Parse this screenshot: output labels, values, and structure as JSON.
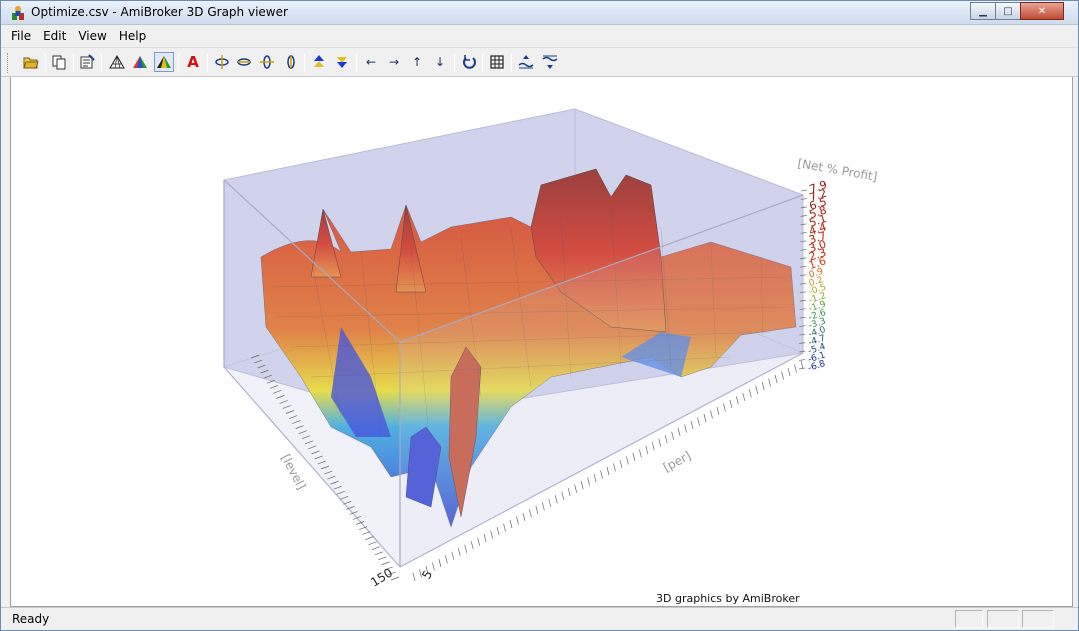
{
  "window": {
    "title": "Optimize.csv - AmiBroker 3D Graph viewer",
    "icon": "amibroker-app-icon",
    "controls": [
      "minimize",
      "maximize",
      "close"
    ]
  },
  "menu": {
    "items": [
      "File",
      "Edit",
      "View",
      "Help"
    ]
  },
  "toolbar": {
    "buttons": [
      {
        "name": "open-file-icon"
      },
      {
        "name": "copy-icon"
      },
      {
        "name": "properties-icon"
      },
      {
        "name": "wireframe-icon"
      },
      {
        "name": "shaded-icon"
      },
      {
        "name": "solid-shaded-icon",
        "active": true
      },
      {
        "name": "axis-labels-icon"
      },
      {
        "name": "rotate-x-ccw-icon"
      },
      {
        "name": "rotate-x-cw-icon"
      },
      {
        "name": "rotate-y-ccw-icon"
      },
      {
        "name": "rotate-y-cw-icon"
      },
      {
        "name": "zoom-in-icon"
      },
      {
        "name": "zoom-out-icon"
      },
      {
        "name": "move-left-icon"
      },
      {
        "name": "move-right-icon"
      },
      {
        "name": "move-up-icon"
      },
      {
        "name": "move-down-icon"
      },
      {
        "name": "reset-view-icon"
      },
      {
        "name": "grid-icon"
      },
      {
        "name": "raise-water-level-icon"
      },
      {
        "name": "lower-water-level-icon"
      }
    ],
    "glyphs": {
      "axis_labels": "A",
      "left": "←",
      "right": "→",
      "up": "↑",
      "down": "↓"
    }
  },
  "chart": {
    "z_axis_label": "[Net % Profit]",
    "z_ticks": [
      "7.9",
      "7.2",
      "6.5",
      "5.8",
      "5.1",
      "4.4",
      "3.7",
      "3.0",
      "2.3",
      "1.6",
      "0.9",
      "0.2",
      "-0.5",
      "-1.2",
      "-1.9",
      "-2.6",
      "-3.3",
      "-4.0",
      "-4.7",
      "-5.4",
      "-6.1",
      "-6.8"
    ],
    "x_axis_label": "[level]",
    "y_axis_label": "[per]",
    "level_first_tick": "150",
    "per_first_tick": "5",
    "credit": "3D graphics by AmiBroker",
    "colors": {
      "box_fill": "#c9cbe6",
      "surface_high": "#d6210a",
      "surface_mid": "#f2e21a",
      "surface_low": "#1d2fd0",
      "axis_label": "#9a9a9a"
    }
  },
  "status": {
    "text": "Ready"
  }
}
